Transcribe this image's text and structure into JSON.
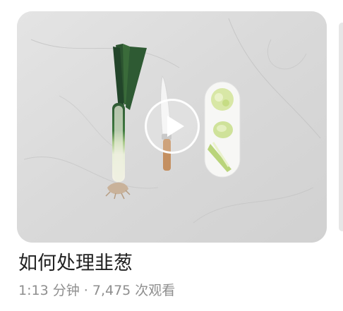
{
  "video": {
    "title": "如何处理韭葱",
    "duration": "1:13 分钟",
    "separator": "·",
    "views": "7,475 次观看"
  },
  "icons": {
    "play": "play-icon"
  },
  "colors": {
    "title": "#222222",
    "meta": "#8e8e8e",
    "background": "#ffffff"
  }
}
